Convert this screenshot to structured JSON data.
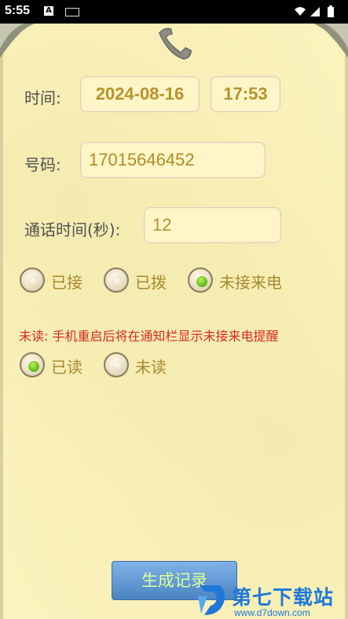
{
  "status_bar": {
    "time": "5:55",
    "icons": [
      "a-icon",
      "keyboard-icon",
      "wifi-icon",
      "signal-icon",
      "battery-icon"
    ]
  },
  "form": {
    "time_label": "时间:",
    "date_value": "2024-08-16",
    "time_value": "17:53",
    "number_label": "号码:",
    "number_value": "17015646452",
    "duration_label": "通话时间(秒):",
    "duration_value": "12"
  },
  "call_type": {
    "options": [
      {
        "label": "已接",
        "selected": false
      },
      {
        "label": "已拨",
        "selected": false
      },
      {
        "label": "未接来电",
        "selected": true
      }
    ]
  },
  "notice": "未读: 手机重启后将在通知栏显示未接来电提醒",
  "read_status": {
    "options": [
      {
        "label": "已读",
        "selected": true
      },
      {
        "label": "未读",
        "selected": false
      }
    ]
  },
  "generate_button": "生成记录",
  "watermark": {
    "title": "第七下载站",
    "url": "www.d7down.com"
  },
  "colors": {
    "background": "#fbf3bd",
    "field_text": "#b8912a",
    "notice_text": "#d62c20",
    "button_blue": "#4b84c2",
    "radio_green": "#6cc320"
  }
}
